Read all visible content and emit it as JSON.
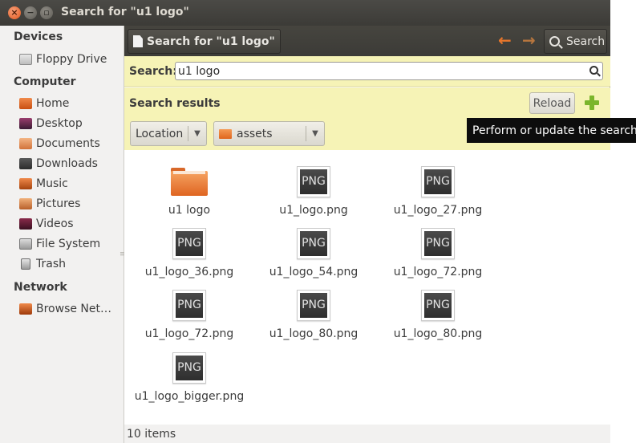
{
  "window": {
    "title": "Search for \"u1 logo\""
  },
  "sidebar": {
    "sections": [
      {
        "heading": "Devices",
        "items": [
          {
            "label": "Floppy Drive",
            "icon": "floppy-icon"
          }
        ]
      },
      {
        "heading": "Computer",
        "items": [
          {
            "label": "Home",
            "icon": "home-icon"
          },
          {
            "label": "Desktop",
            "icon": "desktop-icon"
          },
          {
            "label": "Documents",
            "icon": "documents-icon"
          },
          {
            "label": "Downloads",
            "icon": "downloads-icon"
          },
          {
            "label": "Music",
            "icon": "music-icon"
          },
          {
            "label": "Pictures",
            "icon": "pictures-icon"
          },
          {
            "label": "Videos",
            "icon": "videos-icon"
          },
          {
            "label": "File System",
            "icon": "filesystem-icon"
          },
          {
            "label": "Trash",
            "icon": "trash-icon"
          }
        ]
      },
      {
        "heading": "Network",
        "items": [
          {
            "label": "Browse Net…",
            "icon": "network-icon"
          }
        ]
      }
    ]
  },
  "toolbar": {
    "path_label": "Search for \"u1 logo\"",
    "search_label": "Search",
    "back_glyph": "←",
    "forward_glyph": "→"
  },
  "search": {
    "label": "Search:",
    "value": "u1 logo",
    "results_title": "Search results",
    "reload_label": "Reload",
    "location_label": "Location",
    "folder_label": "assets"
  },
  "tooltip": {
    "text": "Perform or update the search"
  },
  "files": [
    {
      "name": "u1 logo",
      "type": "folder",
      "badge": ""
    },
    {
      "name": "u1_logo.png",
      "type": "png",
      "badge": "PNG"
    },
    {
      "name": "u1_logo_27.png",
      "type": "png",
      "badge": "PNG"
    },
    {
      "name": "u1_logo_36.png",
      "type": "png",
      "badge": "PNG"
    },
    {
      "name": "u1_logo_54.png",
      "type": "png",
      "badge": "PNG"
    },
    {
      "name": "u1_logo_72.png",
      "type": "png",
      "badge": "PNG"
    },
    {
      "name": "u1_logo_72.png",
      "type": "png",
      "badge": "PNG"
    },
    {
      "name": "u1_logo_80.png",
      "type": "png",
      "badge": "PNG"
    },
    {
      "name": "u1_logo_80.png",
      "type": "png",
      "badge": "PNG"
    },
    {
      "name": "u1_logo_bigger.png",
      "type": "png",
      "badge": "PNG"
    }
  ],
  "status": {
    "text": "10 items"
  },
  "colors": {
    "accent_orange": "#e2561c",
    "search_bar_bg": "#f6f3b6",
    "toolbar_bg": "#3c3b37"
  }
}
